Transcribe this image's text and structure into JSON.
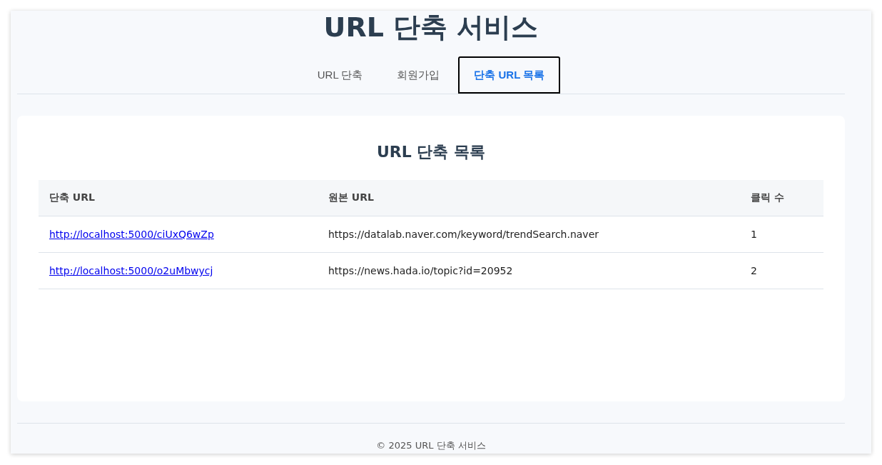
{
  "header": {
    "title": "URL 단축 서비스"
  },
  "tabs": [
    {
      "label": "URL 단축",
      "selected": false
    },
    {
      "label": "회원가입",
      "selected": false
    },
    {
      "label": "단축 URL 목록",
      "selected": true
    }
  ],
  "list": {
    "title": "URL 단축 목록",
    "columns": [
      "단축 URL",
      "원본 URL",
      "클릭 수"
    ],
    "rows": [
      {
        "short_url": "http://localhost:5000/ciUxQ6wZp",
        "original_url": "https://datalab.naver.com/keyword/trendSearch.naver",
        "clicks": "1"
      },
      {
        "short_url": "http://localhost:5000/o2uMbwycj",
        "original_url": "https://news.hada.io/topic?id=20952",
        "clicks": "2"
      }
    ]
  },
  "footer": {
    "text": "© 2025 URL 단축 서비스"
  }
}
